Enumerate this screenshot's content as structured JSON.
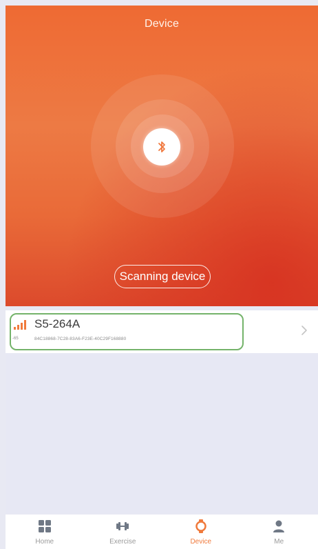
{
  "header": {
    "title": "Device"
  },
  "scanner": {
    "status_label": "Scanning device",
    "icon": "bluetooth-icon"
  },
  "devices": [
    {
      "name": "S5-264A",
      "rssi": "-65",
      "id": "84C18868-7C28-83A6-F23E-40C29F168880",
      "signal_icon": "signal-strength-icon"
    }
  ],
  "tabbar": {
    "tabs": [
      {
        "label": "Home",
        "icon": "home-grid-icon",
        "active": false
      },
      {
        "label": "Exercise",
        "icon": "dumbbell-icon",
        "active": false
      },
      {
        "label": "Device",
        "icon": "watch-icon",
        "active": true
      },
      {
        "label": "Me",
        "icon": "person-icon",
        "active": false
      }
    ]
  },
  "colors": {
    "accent": "#f07a3c",
    "header_top": "#ee6a33",
    "header_bottom": "#dc4a2c",
    "highlight": "#74b36a",
    "list_bg": "#e7e8f4"
  }
}
